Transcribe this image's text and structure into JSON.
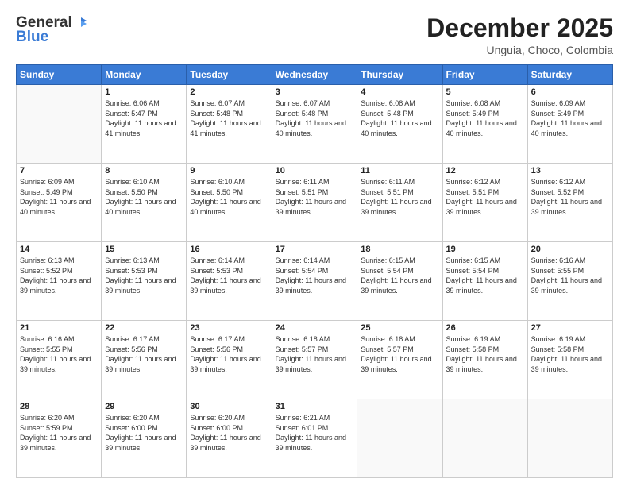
{
  "header": {
    "logo_general": "General",
    "logo_blue": "Blue",
    "month_title": "December 2025",
    "location": "Unguia, Choco, Colombia"
  },
  "days_of_week": [
    "Sunday",
    "Monday",
    "Tuesday",
    "Wednesday",
    "Thursday",
    "Friday",
    "Saturday"
  ],
  "weeks": [
    [
      {
        "day": "",
        "sunrise": "",
        "sunset": "",
        "daylight": ""
      },
      {
        "day": "1",
        "sunrise": "Sunrise: 6:06 AM",
        "sunset": "Sunset: 5:47 PM",
        "daylight": "Daylight: 11 hours and 41 minutes."
      },
      {
        "day": "2",
        "sunrise": "Sunrise: 6:07 AM",
        "sunset": "Sunset: 5:48 PM",
        "daylight": "Daylight: 11 hours and 41 minutes."
      },
      {
        "day": "3",
        "sunrise": "Sunrise: 6:07 AM",
        "sunset": "Sunset: 5:48 PM",
        "daylight": "Daylight: 11 hours and 40 minutes."
      },
      {
        "day": "4",
        "sunrise": "Sunrise: 6:08 AM",
        "sunset": "Sunset: 5:48 PM",
        "daylight": "Daylight: 11 hours and 40 minutes."
      },
      {
        "day": "5",
        "sunrise": "Sunrise: 6:08 AM",
        "sunset": "Sunset: 5:49 PM",
        "daylight": "Daylight: 11 hours and 40 minutes."
      },
      {
        "day": "6",
        "sunrise": "Sunrise: 6:09 AM",
        "sunset": "Sunset: 5:49 PM",
        "daylight": "Daylight: 11 hours and 40 minutes."
      }
    ],
    [
      {
        "day": "7",
        "sunrise": "Sunrise: 6:09 AM",
        "sunset": "Sunset: 5:49 PM",
        "daylight": "Daylight: 11 hours and 40 minutes."
      },
      {
        "day": "8",
        "sunrise": "Sunrise: 6:10 AM",
        "sunset": "Sunset: 5:50 PM",
        "daylight": "Daylight: 11 hours and 40 minutes."
      },
      {
        "day": "9",
        "sunrise": "Sunrise: 6:10 AM",
        "sunset": "Sunset: 5:50 PM",
        "daylight": "Daylight: 11 hours and 40 minutes."
      },
      {
        "day": "10",
        "sunrise": "Sunrise: 6:11 AM",
        "sunset": "Sunset: 5:51 PM",
        "daylight": "Daylight: 11 hours and 39 minutes."
      },
      {
        "day": "11",
        "sunrise": "Sunrise: 6:11 AM",
        "sunset": "Sunset: 5:51 PM",
        "daylight": "Daylight: 11 hours and 39 minutes."
      },
      {
        "day": "12",
        "sunrise": "Sunrise: 6:12 AM",
        "sunset": "Sunset: 5:51 PM",
        "daylight": "Daylight: 11 hours and 39 minutes."
      },
      {
        "day": "13",
        "sunrise": "Sunrise: 6:12 AM",
        "sunset": "Sunset: 5:52 PM",
        "daylight": "Daylight: 11 hours and 39 minutes."
      }
    ],
    [
      {
        "day": "14",
        "sunrise": "Sunrise: 6:13 AM",
        "sunset": "Sunset: 5:52 PM",
        "daylight": "Daylight: 11 hours and 39 minutes."
      },
      {
        "day": "15",
        "sunrise": "Sunrise: 6:13 AM",
        "sunset": "Sunset: 5:53 PM",
        "daylight": "Daylight: 11 hours and 39 minutes."
      },
      {
        "day": "16",
        "sunrise": "Sunrise: 6:14 AM",
        "sunset": "Sunset: 5:53 PM",
        "daylight": "Daylight: 11 hours and 39 minutes."
      },
      {
        "day": "17",
        "sunrise": "Sunrise: 6:14 AM",
        "sunset": "Sunset: 5:54 PM",
        "daylight": "Daylight: 11 hours and 39 minutes."
      },
      {
        "day": "18",
        "sunrise": "Sunrise: 6:15 AM",
        "sunset": "Sunset: 5:54 PM",
        "daylight": "Daylight: 11 hours and 39 minutes."
      },
      {
        "day": "19",
        "sunrise": "Sunrise: 6:15 AM",
        "sunset": "Sunset: 5:54 PM",
        "daylight": "Daylight: 11 hours and 39 minutes."
      },
      {
        "day": "20",
        "sunrise": "Sunrise: 6:16 AM",
        "sunset": "Sunset: 5:55 PM",
        "daylight": "Daylight: 11 hours and 39 minutes."
      }
    ],
    [
      {
        "day": "21",
        "sunrise": "Sunrise: 6:16 AM",
        "sunset": "Sunset: 5:55 PM",
        "daylight": "Daylight: 11 hours and 39 minutes."
      },
      {
        "day": "22",
        "sunrise": "Sunrise: 6:17 AM",
        "sunset": "Sunset: 5:56 PM",
        "daylight": "Daylight: 11 hours and 39 minutes."
      },
      {
        "day": "23",
        "sunrise": "Sunrise: 6:17 AM",
        "sunset": "Sunset: 5:56 PM",
        "daylight": "Daylight: 11 hours and 39 minutes."
      },
      {
        "day": "24",
        "sunrise": "Sunrise: 6:18 AM",
        "sunset": "Sunset: 5:57 PM",
        "daylight": "Daylight: 11 hours and 39 minutes."
      },
      {
        "day": "25",
        "sunrise": "Sunrise: 6:18 AM",
        "sunset": "Sunset: 5:57 PM",
        "daylight": "Daylight: 11 hours and 39 minutes."
      },
      {
        "day": "26",
        "sunrise": "Sunrise: 6:19 AM",
        "sunset": "Sunset: 5:58 PM",
        "daylight": "Daylight: 11 hours and 39 minutes."
      },
      {
        "day": "27",
        "sunrise": "Sunrise: 6:19 AM",
        "sunset": "Sunset: 5:58 PM",
        "daylight": "Daylight: 11 hours and 39 minutes."
      }
    ],
    [
      {
        "day": "28",
        "sunrise": "Sunrise: 6:20 AM",
        "sunset": "Sunset: 5:59 PM",
        "daylight": "Daylight: 11 hours and 39 minutes."
      },
      {
        "day": "29",
        "sunrise": "Sunrise: 6:20 AM",
        "sunset": "Sunset: 6:00 PM",
        "daylight": "Daylight: 11 hours and 39 minutes."
      },
      {
        "day": "30",
        "sunrise": "Sunrise: 6:20 AM",
        "sunset": "Sunset: 6:00 PM",
        "daylight": "Daylight: 11 hours and 39 minutes."
      },
      {
        "day": "31",
        "sunrise": "Sunrise: 6:21 AM",
        "sunset": "Sunset: 6:01 PM",
        "daylight": "Daylight: 11 hours and 39 minutes."
      },
      {
        "day": "",
        "sunrise": "",
        "sunset": "",
        "daylight": ""
      },
      {
        "day": "",
        "sunrise": "",
        "sunset": "",
        "daylight": ""
      },
      {
        "day": "",
        "sunrise": "",
        "sunset": "",
        "daylight": ""
      }
    ]
  ]
}
